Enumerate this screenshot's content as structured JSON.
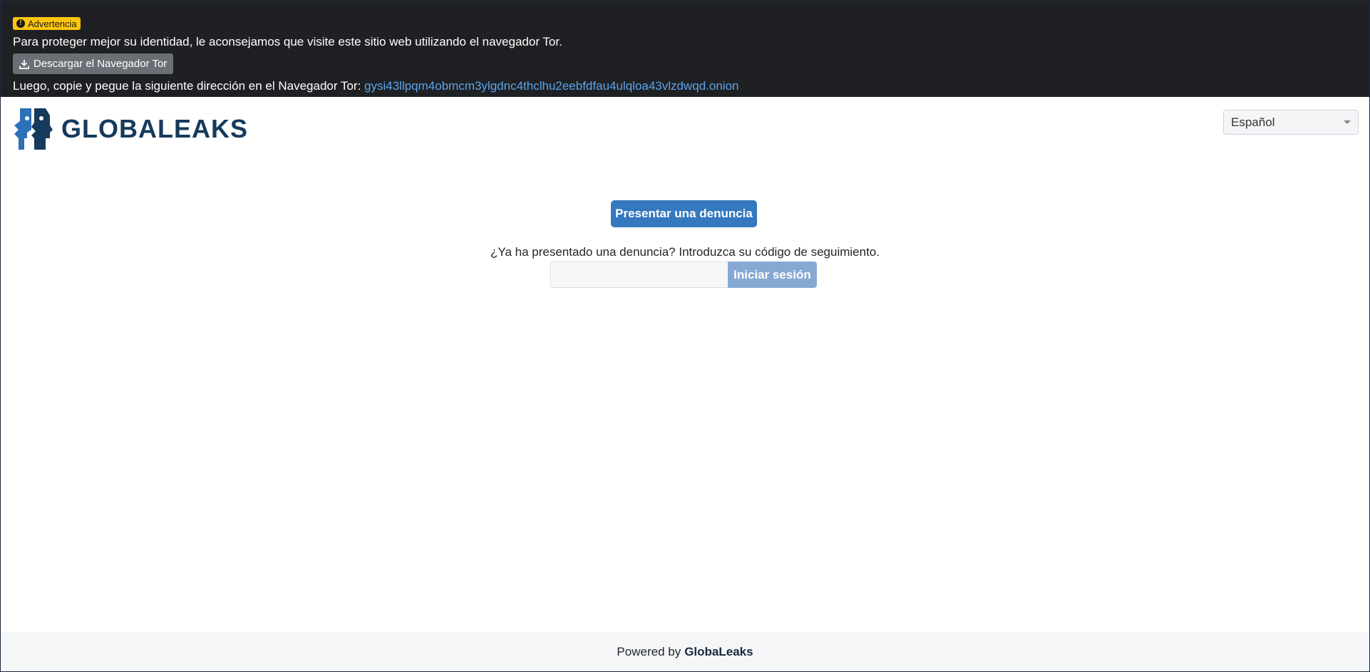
{
  "tor_banner": {
    "badge_label": "Advertencia",
    "badge_icon": "exclamation-circle-icon",
    "message": "Para proteger mejor su identidad, le aconsejamos que visite este sitio web utilizando el navegador Tor.",
    "download_label": "Descargar el Navegador Tor",
    "download_icon": "download-icon",
    "address_prefix": "Luego, copie y pegue la siguiente dirección en el Navegador Tor:",
    "onion_address": "gysi43llpqm4obmcm3ylgdnc4thclhu2eebfdfau4ulqloa43vlzdwqd.onion"
  },
  "header": {
    "logo_text": "GLOBALEAKS",
    "language_selected": "Español"
  },
  "main": {
    "submit_label": "Presentar una denuncia",
    "receipt_prompt": "¿Ya ha presentado una denuncia? Introduzca su código de seguimiento.",
    "receipt_value": "",
    "receipt_placeholder": "",
    "login_label": "Iniciar sesión"
  },
  "footer": {
    "powered_by": "Powered by",
    "brand": "GlobaLeaks"
  },
  "colors": {
    "banner_bg": "#1f2023",
    "badge_bg": "#ffc60f",
    "primary": "#3478bf",
    "primary_disabled": "#86a9d4",
    "link": "#5aa4ec",
    "logo": "#163a5c",
    "footer_bg": "#f5f6f8"
  }
}
